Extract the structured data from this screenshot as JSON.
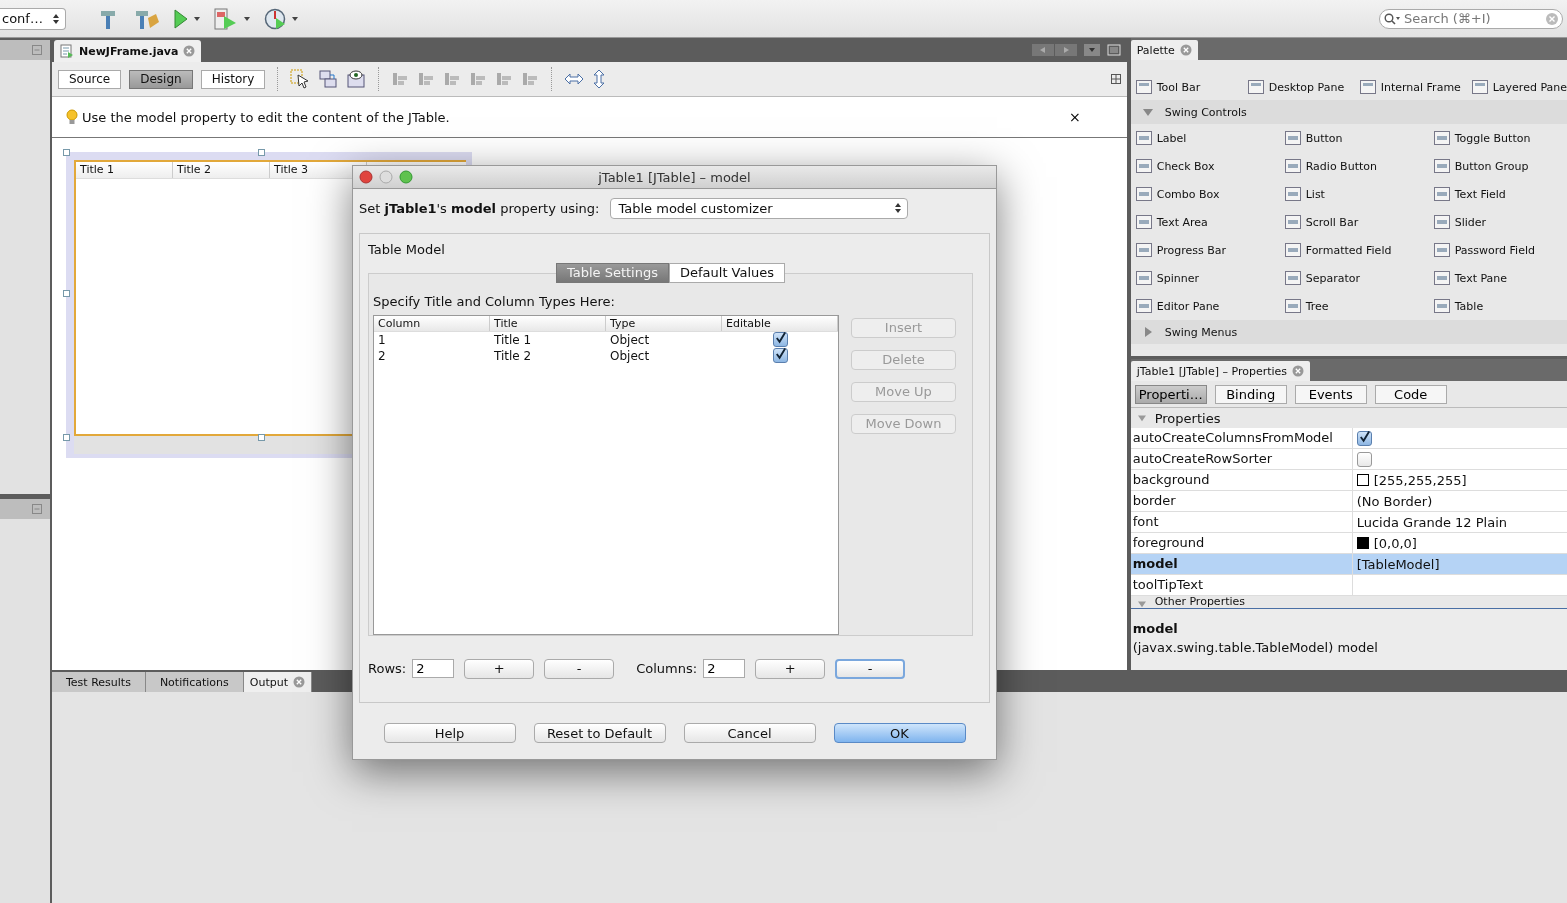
{
  "toolbar": {
    "config_combo": "conf…",
    "search": {
      "placeholder": "Search (⌘+I)"
    }
  },
  "editor": {
    "tab": "NewJFrame.java",
    "views": [
      {
        "label": "Source",
        "selected": false
      },
      {
        "label": "Design",
        "selected": true
      },
      {
        "label": "History",
        "selected": false
      }
    ],
    "hint": "Use the model property to edit the content of the JTable.",
    "hint_close": "×",
    "design_table": {
      "columns": [
        "Title 1",
        "Title 2",
        "Title 3"
      ]
    }
  },
  "bottom_tabs": [
    {
      "label": "Test Results",
      "selected": false
    },
    {
      "label": "Notifications",
      "selected": false
    },
    {
      "label": "Output",
      "selected": true
    }
  ],
  "palette": {
    "title": "Palette",
    "top_row": [
      "Tool Bar",
      "Desktop Pane",
      "Internal Frame",
      "Layered Pane"
    ],
    "sections": [
      {
        "label": "Swing Controls",
        "expanded": true,
        "items": [
          "Label",
          "Button",
          "Toggle Button",
          "Check Box",
          "Radio Button",
          "Button Group",
          "Combo Box",
          "List",
          "Text Field",
          "Text Area",
          "Scroll Bar",
          "Slider",
          "Progress Bar",
          "Formatted Field",
          "Password Field",
          "Spinner",
          "Separator",
          "Text Pane",
          "Editor Pane",
          "Tree",
          "Table"
        ]
      },
      {
        "label": "Swing Menus",
        "expanded": false
      }
    ]
  },
  "properties": {
    "title": "jTable1 [JTable] – Properties",
    "tabs": [
      {
        "label": "Properti…",
        "selected": true
      },
      {
        "label": "Binding",
        "selected": false
      },
      {
        "label": "Events",
        "selected": false
      },
      {
        "label": "Code",
        "selected": false
      }
    ],
    "section": {
      "label": "Properties",
      "expanded": true
    },
    "rows": [
      {
        "name": "autoCreateColumnsFromModel",
        "kind": "checkbox",
        "checked": true,
        "selected": false
      },
      {
        "name": "autoCreateRowSorter",
        "kind": "checkbox",
        "checked": false,
        "selected": false
      },
      {
        "name": "background",
        "kind": "color",
        "value": "[255,255,255]",
        "color": "#ffffff",
        "selected": false
      },
      {
        "name": "border",
        "kind": "text",
        "value": "(No Border)",
        "selected": false
      },
      {
        "name": "font",
        "kind": "text",
        "value": "Lucida Grande 12 Plain",
        "selected": false
      },
      {
        "name": "foreground",
        "kind": "color",
        "value": "[0,0,0]",
        "color": "#000000",
        "selected": false
      },
      {
        "name": "model",
        "kind": "text",
        "value": "[TableModel]",
        "selected": true
      },
      {
        "name": "toolTipText",
        "kind": "text",
        "selected": false
      }
    ],
    "other_section": {
      "label": "Other Properties",
      "expanded": true
    },
    "description": {
      "title": "model",
      "text": "(javax.swing.table.TableModel) model"
    }
  },
  "dialog": {
    "title": "jTable1 [JTable] – model",
    "using_label": "Set **jTable1**'s **model** property using:",
    "using_value": "Table model customizer",
    "group": "Table Model",
    "tabs": [
      {
        "label": "Table Settings",
        "selected": true
      },
      {
        "label": "Default Values",
        "selected": false
      }
    ],
    "instruction": "Specify Title and Column Types Here:",
    "columns": [
      "Column",
      "Title",
      "Type",
      "Editable"
    ],
    "rows": [
      {
        "column": "1",
        "title": "Title 1",
        "type": "Object",
        "editable": true
      },
      {
        "column": "2",
        "title": "Title 2",
        "type": "Object",
        "editable": true
      }
    ],
    "side_buttons": [
      {
        "label": "Insert",
        "disabled": true
      },
      {
        "label": "Delete",
        "disabled": true
      },
      {
        "label": "Move Up",
        "disabled": true
      },
      {
        "label": "Move Down",
        "disabled": true
      }
    ],
    "counts": [
      {
        "label": "Rows:",
        "value": "2",
        "buttons": [
          {
            "label": "+",
            "focused": false
          },
          {
            "label": "-",
            "focused": false
          }
        ]
      },
      {
        "label": "Columns:",
        "value": "2",
        "buttons": [
          {
            "label": "+",
            "focused": false
          },
          {
            "label": "-",
            "focused": true
          }
        ]
      }
    ],
    "buttons": [
      {
        "label": "Help",
        "default": false
      },
      {
        "label": "Reset to Default",
        "default": false
      },
      {
        "label": "Cancel",
        "default": false
      },
      {
        "label": "OK",
        "default": true
      }
    ]
  }
}
